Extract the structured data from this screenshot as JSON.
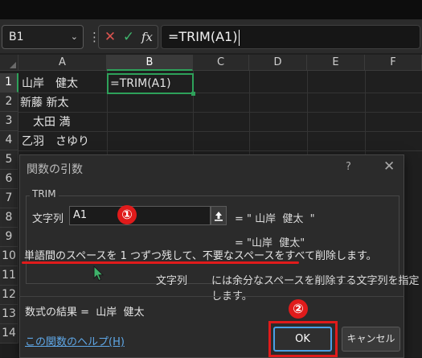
{
  "formula_bar": {
    "name_box": "B1",
    "name_box_chevron": "⌄",
    "more_dots": "⋮",
    "cancel_glyph": "✕",
    "enter_glyph": "✓",
    "fx_glyph": "fx",
    "formula": "=TRIM(A1)"
  },
  "grid": {
    "columns": [
      "A",
      "B",
      "C",
      "D",
      "E",
      "F"
    ],
    "selected_column": "B",
    "rows": [
      "1",
      "2",
      "3",
      "4",
      "5",
      "6",
      "7",
      "8",
      "9",
      "10",
      "11",
      "12",
      "13",
      "14"
    ],
    "selected_row": "1",
    "cells": {
      "A1": "山岸　健太",
      "B1": "=TRIM(A1)",
      "A2": "新藤 新太",
      "A3": "　太田 満",
      "A4": "乙羽　さゆり"
    }
  },
  "dialog": {
    "title": "関数の引数",
    "help_glyph": "?",
    "close_glyph": "✕",
    "function_name": "TRIM",
    "arg_label": "文字列",
    "arg_value": "A1",
    "arg_preview": "= \" 山岸  健太  \"",
    "result_preview": "= \"山岸  健太\"",
    "description": "単語間のスペースを 1 つずつ残して、不要なスペースをすべて削除します。",
    "arg_desc_title": "文字列",
    "arg_desc": "には余分なスペースを削除する文字列を指定します。",
    "formula_result_label": "数式の結果 =",
    "formula_result_value": "山岸  健太",
    "help_link": "この関数のヘルプ(H)",
    "ok_label": "OK",
    "cancel_label": "キャンセル"
  },
  "annotations": {
    "marker_1": "①",
    "marker_2": "②",
    "highlight_color": "#e01b1b"
  },
  "colors": {
    "accent_green": "#2ea15a",
    "button_focus_blue": "#4aa0e6",
    "link_blue": "#5fa8e8"
  }
}
